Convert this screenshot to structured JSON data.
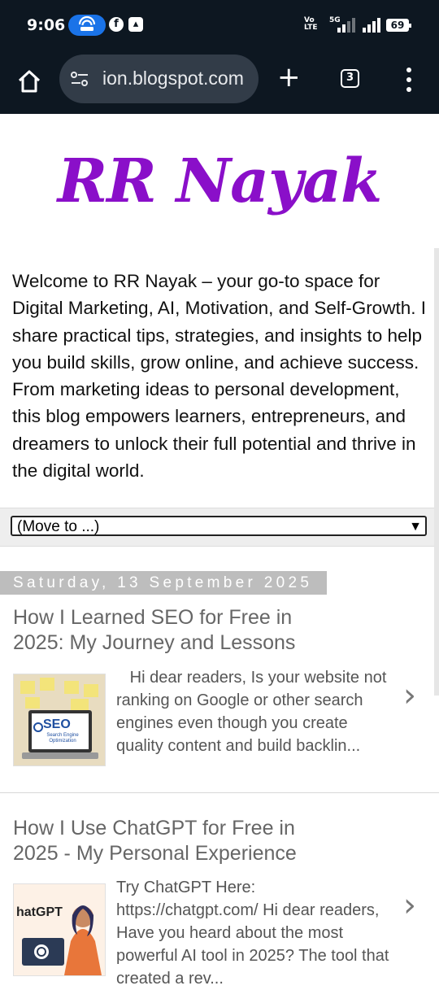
{
  "status_bar": {
    "time": "9:06",
    "network_label_top": "Vo",
    "network_label_bottom": "LTE",
    "network_5g": "5G",
    "battery": "69"
  },
  "browser": {
    "url": "ion.blogspot.com",
    "tab_count": "3"
  },
  "blog": {
    "title": "RR Nayak",
    "description": "Welcome to RR Nayak – your go-to space for Digital Marketing, AI, Motivation, and Self-Growth. I share practical tips, strategies, and insights to help you build skills, grow online, and achieve success. From marketing ideas to personal development, this blog empowers learners, entrepreneurs, and dreamers to unlock their full potential and thrive in the digital world.",
    "move_to": "(Move to ...)",
    "date": "Saturday, 13 September 2025",
    "posts": [
      {
        "title": "How I Learned SEO for Free in 2025: My Journey and Lessons",
        "snippet": "   Hi dear readers, Is your website not ranking on Google or other search engines even though you create quality content and build backlin...",
        "thumb_text": "SEO",
        "thumb_subtext": "Search Engine Optimization"
      },
      {
        "title": "How I Use ChatGPT for Free in 2025 - My Personal Experience",
        "snippet": "Try ChatGPT Here: https://chatgpt.com/ Hi dear readers, Have you heard about the most powerful AI tool in 2025? The tool that created a rev...",
        "thumb_text": "hatGPT"
      }
    ]
  },
  "colors": {
    "status_bg": "#0d1721",
    "accent": "#8a0fc9"
  }
}
